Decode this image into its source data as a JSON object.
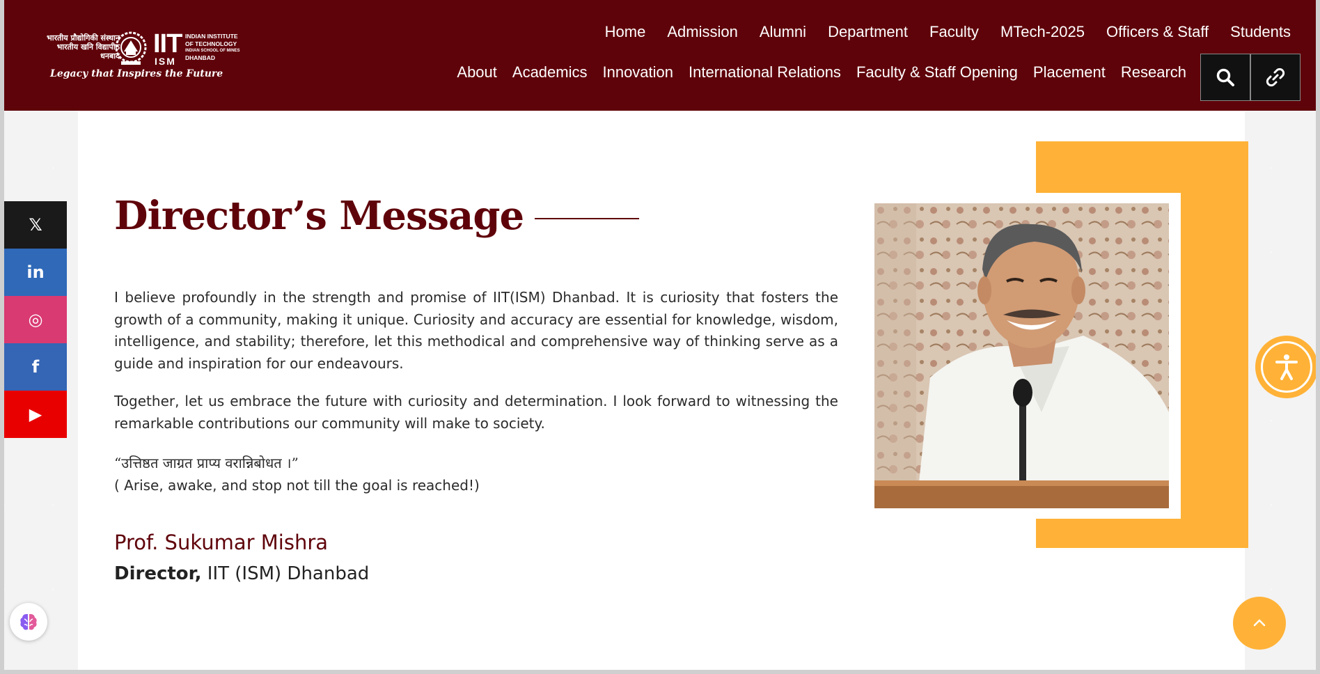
{
  "logo": {
    "hindi_lines": [
      "भारतीय प्रौद्योगिकी संस्थान",
      "भारतीय खनि विद्यापीठ",
      "धनबाद"
    ],
    "iit": "IIT",
    "ism": "ISM",
    "english_lines": [
      "INDIAN INSTITUTE",
      "OF TECHNOLOGY",
      "INDIAN SCHOOL OF MINES",
      "DHANBAD"
    ],
    "tagline": "Legacy that Inspires the Future"
  },
  "nav": {
    "top": [
      "Home",
      "Admission",
      "Alumni",
      "Department",
      "Faculty",
      "MTech-2025",
      "Officers & Staff",
      "Students"
    ],
    "bottom": [
      "About",
      "Academics",
      "Innovation",
      "International Relations",
      "Faculty & Staff Opening",
      "Placement",
      "Research"
    ]
  },
  "header_buttons": {
    "search_icon": "search-icon",
    "link_icon": "link-icon"
  },
  "message": {
    "title": "Director’s Message",
    "paragraph1": "I believe profoundly in the strength and promise of IIT(ISM) Dhanbad. It is curiosity that fosters the growth of a community, making it unique. Curiosity and accuracy are essential for knowledge, wisdom, intelligence, and stability; therefore, let this methodical and comprehensive way of thinking serve as a guide and inspiration for our endeavours.",
    "paragraph2": "Together, let us embrace the future with curiosity and determination. I look forward to witnessing the remarkable contributions our community will make to society.",
    "quote_hindi": "“उत्तिष्ठत जाग्रत प्राप्य वरान्निबोधत ।”",
    "quote_english": "( Arise, awake, and stop not till the goal is reached!)",
    "name": "Prof. Sukumar Mishra",
    "designation_bold": "Director,",
    "designation_rest": " IIT (ISM) Dhanbad"
  },
  "social": [
    {
      "name": "x",
      "glyph": "𝕏",
      "color": "#1a1a1a"
    },
    {
      "name": "linkedin",
      "glyph": "in",
      "color": "#2f69b8"
    },
    {
      "name": "instagram",
      "glyph": "◎",
      "color": "#d93a72"
    },
    {
      "name": "facebook",
      "glyph": "f",
      "color": "#3565b5"
    },
    {
      "name": "youtube",
      "glyph": "▶",
      "color": "#e80000"
    }
  ],
  "colors": {
    "maroon": "#5f030a",
    "accent": "#ffb237"
  }
}
